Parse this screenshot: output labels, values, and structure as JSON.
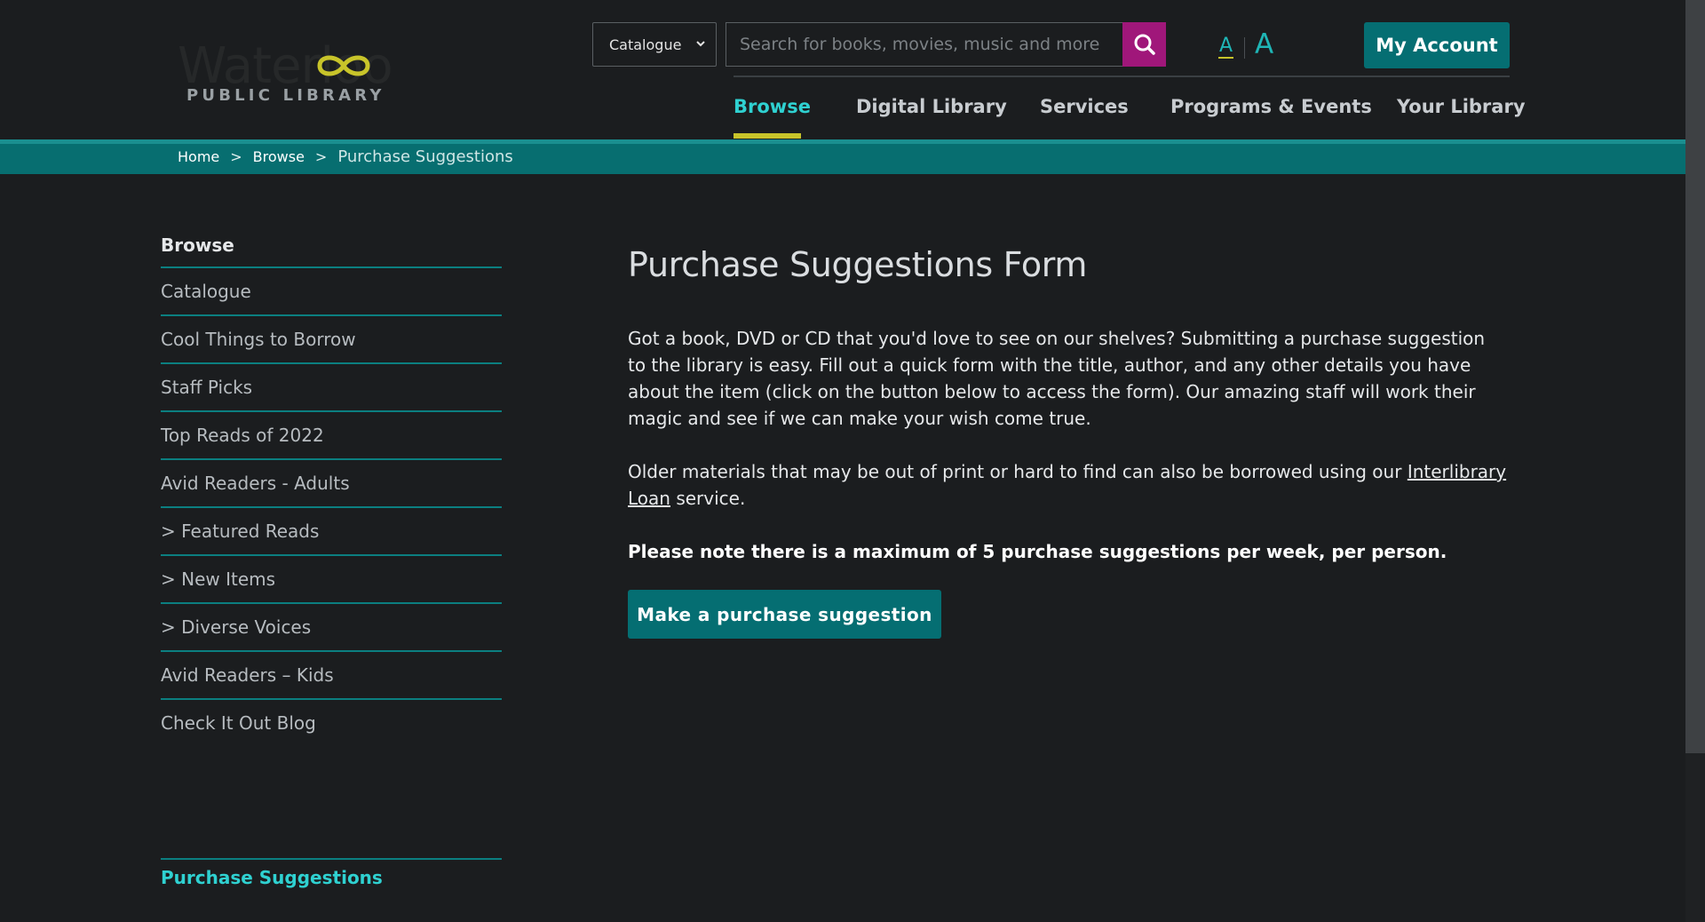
{
  "logo": {
    "word": "Waterloo",
    "subtitle": "PUBLIC LIBRARY",
    "ring_color": "#c8c42a"
  },
  "search": {
    "scope": "Catalogue",
    "placeholder": "Search for books, movies, music and more",
    "button_color": "#a0177a"
  },
  "text_size": {
    "small": "A",
    "large": "A"
  },
  "account": {
    "label": "My Account"
  },
  "nav": {
    "items": [
      {
        "label": "Browse",
        "active": true
      },
      {
        "label": "Digital Library"
      },
      {
        "label": "Services"
      },
      {
        "label": "Programs & Events"
      },
      {
        "label": "Your Library"
      }
    ]
  },
  "breadcrumb": {
    "items": [
      "Home",
      "Browse",
      "Purchase Suggestions"
    ],
    "separator": ">"
  },
  "sidebar": {
    "heading": "Browse",
    "items": [
      "Catalogue",
      "Cool Things to Borrow",
      "Staff Picks",
      "Top Reads of 2022",
      "Avid Readers - Adults",
      "> Featured Reads",
      "> New Items",
      "> Diverse Voices",
      "Avid Readers – Kids",
      "Check It Out Blog"
    ],
    "current": "Purchase Suggestions"
  },
  "main": {
    "title": "Purchase Suggestions Form",
    "p1": "Got a book, DVD or CD that you'd love to see on our shelves? Submitting a purchase suggestion to the library is easy. Fill out a quick form with the title, author, and any other details you have about the item (click on the button below to access the form). Our amazing staff will work their magic and see if we can make your wish come true.",
    "p2_before": "Older materials that may be out of print or hard to find can also be borrowed using our ",
    "p2_link": "Interlibrary Loan",
    "p2_after": " service.",
    "note": "Please note there is a maximum of 5 purchase suggestions per week, per person.",
    "cta": "Make a purchase suggestion"
  },
  "colors": {
    "accent_teal": "#056e72",
    "active_link": "#2fd1d1",
    "highlight_yellow": "#c8c42a"
  }
}
